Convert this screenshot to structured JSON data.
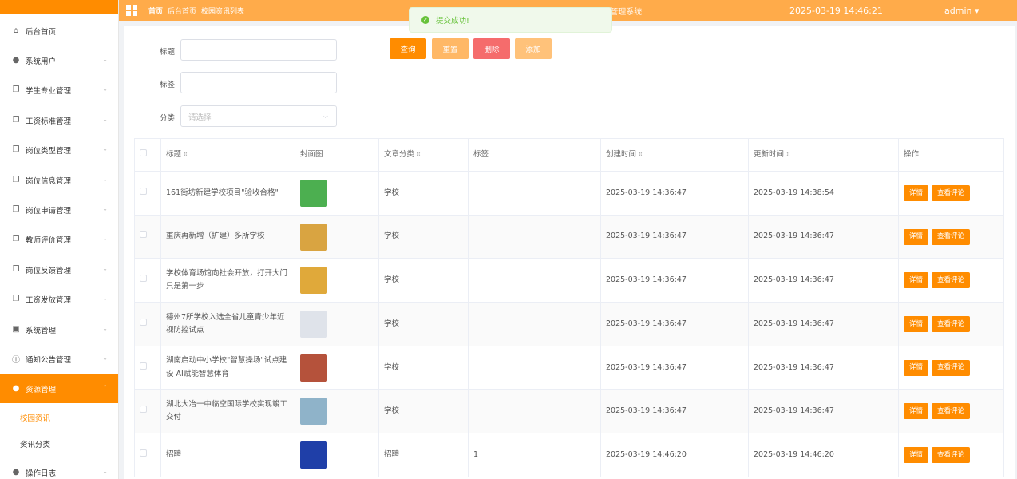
{
  "header": {
    "breadcrumb": [
      "首页",
      "后台首页",
      "校园资讯列表"
    ],
    "system_title": "基于SpringBoot的学生勤工俭学管理系统",
    "datetime": "2025-03-19 14:46:21",
    "user": "admin ▾"
  },
  "toast": {
    "message": "提交成功!"
  },
  "sidebar": {
    "items": [
      {
        "label": "后台首页",
        "icon": "home-icon",
        "glyph": "⌂",
        "has_children": false
      },
      {
        "label": "系统用户",
        "icon": "user-icon",
        "glyph": "●",
        "has_children": true
      },
      {
        "label": "学生专业管理",
        "icon": "document-icon",
        "glyph": "❐",
        "has_children": true
      },
      {
        "label": "工资标准管理",
        "icon": "document-icon",
        "glyph": "❐",
        "has_children": true
      },
      {
        "label": "岗位类型管理",
        "icon": "document-icon",
        "glyph": "❐",
        "has_children": true
      },
      {
        "label": "岗位信息管理",
        "icon": "document-icon",
        "glyph": "❐",
        "has_children": true
      },
      {
        "label": "岗位申请管理",
        "icon": "document-icon",
        "glyph": "❐",
        "has_children": true
      },
      {
        "label": "教师评价管理",
        "icon": "document-icon",
        "glyph": "❐",
        "has_children": true
      },
      {
        "label": "岗位反馈管理",
        "icon": "document-icon",
        "glyph": "❐",
        "has_children": true
      },
      {
        "label": "工资发放管理",
        "icon": "document-icon",
        "glyph": "❐",
        "has_children": true
      },
      {
        "label": "系统管理",
        "icon": "picture-icon",
        "glyph": "▣",
        "has_children": true
      },
      {
        "label": "通知公告管理",
        "icon": "info-icon",
        "glyph": "ⓘ",
        "has_children": true
      },
      {
        "label": "资源管理",
        "icon": "location-icon",
        "glyph": "●",
        "has_children": true,
        "active": true
      },
      {
        "label": "操作日志",
        "icon": "user-icon",
        "glyph": "●",
        "has_children": true
      }
    ],
    "sub_items": [
      {
        "label": "校园资讯",
        "selected": true
      },
      {
        "label": "资讯分类",
        "selected": false
      }
    ]
  },
  "filters": {
    "title_label": "标题",
    "tag_label": "标签",
    "category_label": "分类",
    "category_placeholder": "请选择"
  },
  "buttons": {
    "search": "查询",
    "reset": "重置",
    "delete": "删除",
    "add": "添加"
  },
  "colors": {
    "accent": "#ff8c00",
    "header": "#ffab4a",
    "reset": "#ffb866",
    "delete": "#f56c6c",
    "add": "#ffc27a"
  },
  "table": {
    "columns": [
      "标题",
      "封面图",
      "文章分类",
      "标签",
      "创建时间",
      "更新时间",
      "操作"
    ],
    "detail_label": "详情",
    "comment_label": "查看评论",
    "rows": [
      {
        "title": "161街坊新建学校项目\"验收合格\"",
        "category": "学校",
        "tag": "",
        "created": "2025-03-19 14:36:47",
        "updated": "2025-03-19 14:38:54",
        "thumb": "#4caf50"
      },
      {
        "title": "重庆再新增（扩建）多所学校",
        "category": "学校",
        "tag": "",
        "created": "2025-03-19 14:36:47",
        "updated": "2025-03-19 14:36:47",
        "thumb": "#d9a441"
      },
      {
        "title": "学校体育场馆向社会开放，打开大门只是第一步",
        "category": "学校",
        "tag": "",
        "created": "2025-03-19 14:36:47",
        "updated": "2025-03-19 14:36:47",
        "thumb": "#e0a93a"
      },
      {
        "title": "德州7所学校入选全省儿童青少年近视防控试点",
        "category": "学校",
        "tag": "",
        "created": "2025-03-19 14:36:47",
        "updated": "2025-03-19 14:36:47",
        "thumb": "#dfe3ea"
      },
      {
        "title": "湖南启动中小学校\"智慧操场\"试点建设 AI赋能智慧体育",
        "category": "学校",
        "tag": "",
        "created": "2025-03-19 14:36:47",
        "updated": "2025-03-19 14:36:47",
        "thumb": "#b5523b"
      },
      {
        "title": "湖北大冶一中临空国际学校实现竣工交付",
        "category": "学校",
        "tag": "",
        "created": "2025-03-19 14:36:47",
        "updated": "2025-03-19 14:36:47",
        "thumb": "#8fb3c9"
      },
      {
        "title": "招聘",
        "category": "招聘",
        "tag": "1",
        "created": "2025-03-19 14:46:20",
        "updated": "2025-03-19 14:46:20",
        "thumb": "#1f3fa8"
      }
    ]
  }
}
